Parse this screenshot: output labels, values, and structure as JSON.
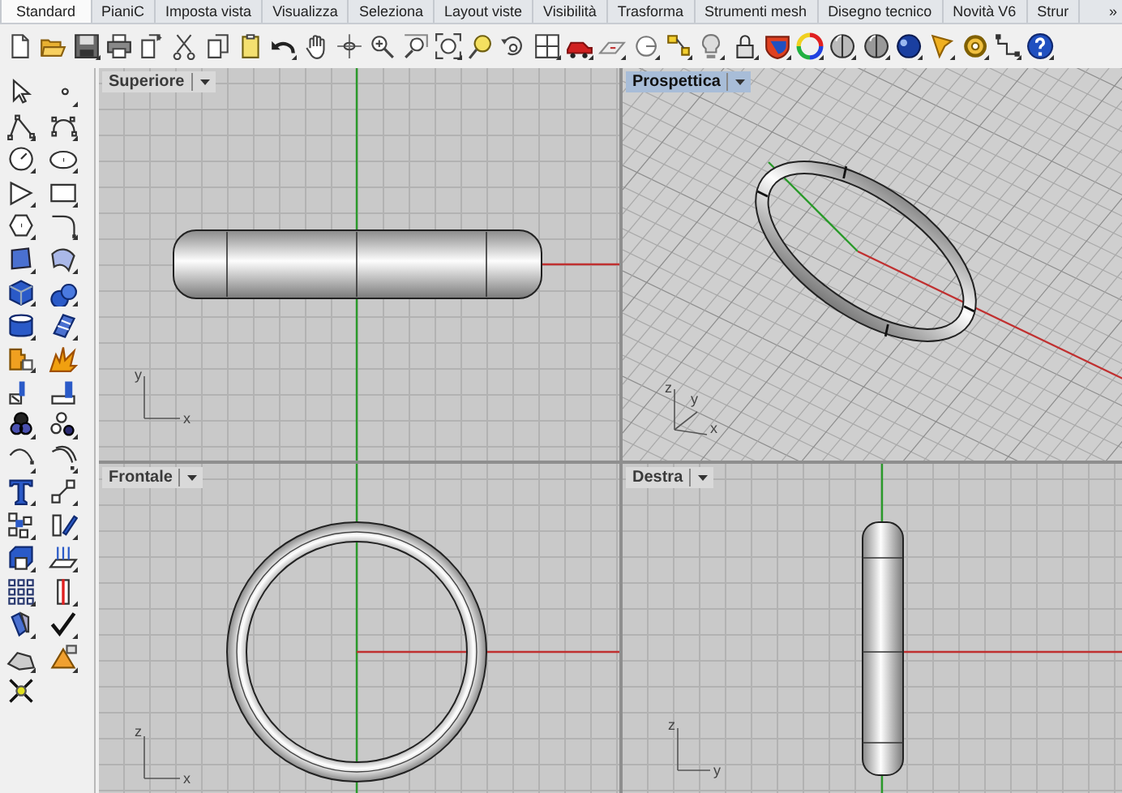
{
  "tabs": [
    {
      "label": "Standard",
      "selected": true
    },
    {
      "label": "PianiC",
      "selected": false
    },
    {
      "label": "Imposta vista",
      "selected": false
    },
    {
      "label": "Visualizza",
      "selected": false
    },
    {
      "label": "Seleziona",
      "selected": false
    },
    {
      "label": "Layout viste",
      "selected": false
    },
    {
      "label": "Visibilità",
      "selected": false
    },
    {
      "label": "Trasforma",
      "selected": false
    },
    {
      "label": "Strumenti mesh",
      "selected": false
    },
    {
      "label": "Disegno tecnico",
      "selected": false
    },
    {
      "label": "Novità V6",
      "selected": false
    },
    {
      "label": "Strur",
      "selected": false
    }
  ],
  "tab_overflow": "»",
  "viewports": [
    {
      "title": "Superiore",
      "selected": false,
      "kind": "top",
      "axis_labels": [
        "y",
        "x"
      ]
    },
    {
      "title": "Prospettica",
      "selected": true,
      "kind": "perspective",
      "axis_labels": [
        "z",
        "y",
        "x"
      ]
    },
    {
      "title": "Frontale",
      "selected": false,
      "kind": "front",
      "axis_labels": [
        "z",
        "x"
      ]
    },
    {
      "title": "Destra",
      "selected": false,
      "kind": "right",
      "axis_labels": [
        "z",
        "y"
      ]
    }
  ]
}
